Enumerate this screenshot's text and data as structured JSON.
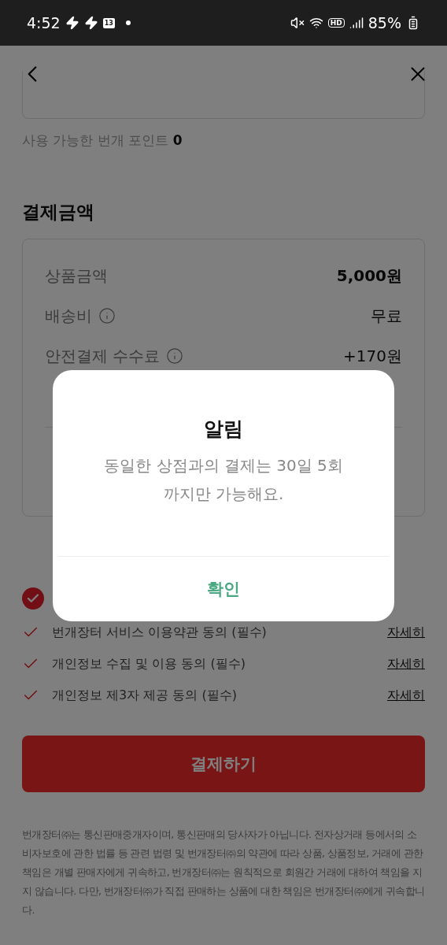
{
  "status_bar": {
    "time": "4:52",
    "calendar_day": "13",
    "hd_label": "HD",
    "battery": "85%"
  },
  "points": {
    "label": "사용 가능한 번개 포인트 **0**"
  },
  "payment": {
    "title": "결제금액",
    "rows": [
      {
        "label": "상품금액",
        "value": "5,000원",
        "kind": "bold"
      },
      {
        "label": "배송비",
        "value": "무료",
        "info": true,
        "kind": "plain"
      },
      {
        "label": "안전결제 수수료",
        "value": "+170원",
        "info": true,
        "kind": "plain"
      },
      {
        "kind": "hidden"
      },
      {
        "kind": "total"
      }
    ]
  },
  "agreements": {
    "all_checked": true,
    "items": [
      {
        "label": "번개장터 서비스 이용약관 동의 (필수)",
        "checked": true,
        "link": "자세히"
      },
      {
        "label": "개인정보 수집 및 이용 동의 (필수)",
        "checked": true,
        "link": "자세히"
      },
      {
        "label": "개인정보 제3자 제공 동의 (필수)",
        "checked": true,
        "link": "자세히"
      }
    ]
  },
  "pay_button": "결제하기",
  "disclaimer": "번개장터㈜는 통신판매중개자이며, 통신판매의 당사자가 아닙니다. 전자상거래 등에서의 소비자보호에 관한 법률 등 관련 법령 및 번개장터㈜의 약관에 따라 상품, 상품정보, 거래에 관한 책임은 개별 판매자에게 귀속하고, 번개장터㈜는 원칙적으로 회원간 거래에 대하여 책임을 지지 않습니다. 다만, 번개장터㈜가 직접 판매하는 상품에 대한 책임은 번개장터㈜에게 귀속합니다.",
  "dialog": {
    "title": "알림",
    "message": "동일한 상점과의 결제는 30일 5회 까지만 가능해요.",
    "confirm": "확인"
  }
}
